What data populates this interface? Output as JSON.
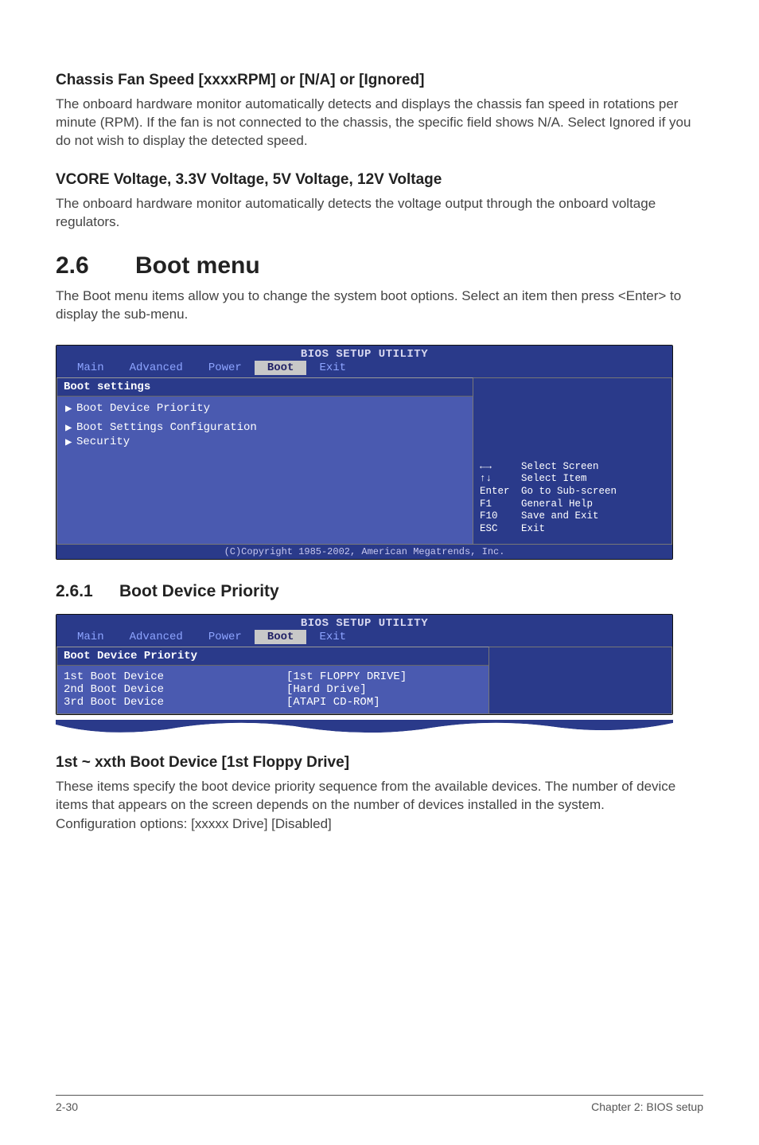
{
  "headings": {
    "chassis_title": "Chassis Fan Speed [xxxxRPM] or [N/A] or [Ignored]",
    "chassis_body": "The onboard hardware monitor automatically detects and displays the chassis fan speed in rotations per minute (RPM). If the fan is not connected to the chassis, the specific field shows N/A. Select Ignored if you do not wish to display the detected speed.",
    "vcore_title": "VCORE Voltage, 3.3V Voltage, 5V Voltage, 12V Voltage",
    "vcore_body": "The onboard hardware monitor automatically detects the voltage output through the onboard voltage regulators.",
    "section_num": "2.6",
    "section_title": "Boot menu",
    "section_body": "The Boot menu items allow you to change the system boot options. Select an item then press <Enter> to display the sub-menu.",
    "subsection_num": "2.6.1",
    "subsection_title": "Boot Device Priority",
    "first_boot_title": "1st ~ xxth Boot Device [1st Floppy Drive]",
    "first_boot_body": "These items specify the boot device priority sequence from the available devices. The number of device items that appears on the screen depends on the number of devices installed in the system.",
    "first_boot_config": "Configuration options: [xxxxx Drive] [Disabled]"
  },
  "bios1": {
    "title": "BIOS SETUP UTILITY",
    "tabs": [
      "Main",
      "Advanced",
      "Power",
      "Boot",
      "Exit"
    ],
    "active_tab": "Boot",
    "left_header": "Boot settings",
    "items": [
      "Boot Device Priority",
      "Boot Settings Configuration",
      "Security"
    ],
    "help": [
      {
        "key": "←→",
        "text": "Select Screen"
      },
      {
        "key": "↑↓",
        "text": "Select Item"
      },
      {
        "key": "Enter",
        "text": "Go to Sub-screen"
      },
      {
        "key": "F1",
        "text": "General Help"
      },
      {
        "key": "F10",
        "text": "Save and Exit"
      },
      {
        "key": "ESC",
        "text": "Exit"
      }
    ],
    "footer": "(C)Copyright 1985-2002, American Megatrends, Inc."
  },
  "bios2": {
    "title": "BIOS SETUP UTILITY",
    "tabs": [
      "Main",
      "Advanced",
      "Power",
      "Boot",
      "Exit"
    ],
    "active_tab": "Boot",
    "left_header": "Boot Device Priority",
    "rows": [
      {
        "label": "1st Boot Device",
        "value": "[1st FLOPPY DRIVE]"
      },
      {
        "label": "2nd Boot Device",
        "value": "[Hard Drive]"
      },
      {
        "label": "3rd Boot Device",
        "value": "[ATAPI CD-ROM]"
      }
    ]
  },
  "footer": {
    "left": "2-30",
    "right": "Chapter 2: BIOS setup"
  }
}
